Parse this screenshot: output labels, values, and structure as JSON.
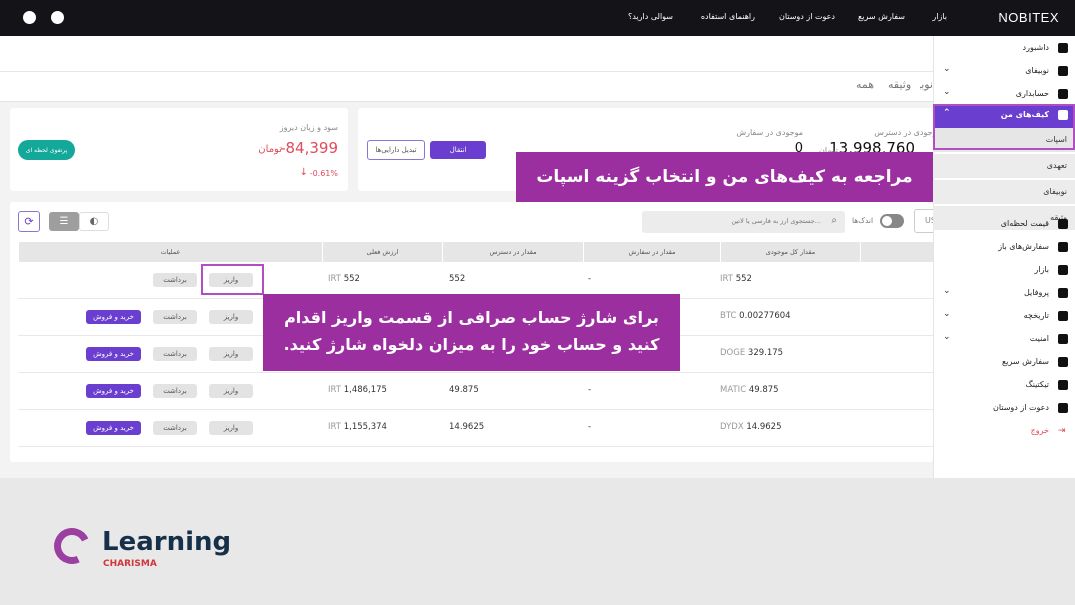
{
  "header": {
    "logo": "NOBITEX",
    "nav": [
      "بازار",
      "سفارش سریع",
      "دعوت از دوستان",
      "راهنمای استفاده",
      "سوالی دارید؟"
    ]
  },
  "tabs": [
    "همه",
    "وثیقه",
    "نوبیفای"
  ],
  "balance_card": {
    "available_label": "موجودی در دسترس",
    "available_value": "13,998,760",
    "available_unit": "تومان",
    "order_label": "موجودی در سفارش",
    "order_value": "0",
    "order_unit": "تومان",
    "transfer_label": "انتقال",
    "convert_label": "تبدیل دارایی‌ها"
  },
  "pnl_card": {
    "label": "سود و زیان دیروز",
    "value": "-84,399",
    "unit": "تومان",
    "percent": "-0.61%",
    "portfolio_label": "پرتفوی لحظه ای"
  },
  "toolbar": {
    "search_placeholder": "جستجوی ارز به فارسی یا لاتین...",
    "small_label": "اندک‌ها",
    "currency": "USDT"
  },
  "table": {
    "headers": [
      "عملیات",
      "ارزش فعلی",
      "مقدار در دسترس",
      "مقدار در سفارش",
      "مقدار کل موجودی"
    ],
    "buttons": {
      "deposit": "واریز",
      "withdraw": "برداشت",
      "trade": "خرید و فروش"
    },
    "rows": [
      {
        "total_unit": "IRT",
        "total": "552",
        "order": "-",
        "available": "552",
        "value_unit": "IRT",
        "value": "552",
        "trade": false
      },
      {
        "total_unit": "BTC",
        "total": "0.00277604",
        "order": "",
        "available": "",
        "value_unit": "",
        "value": "",
        "trade": true
      },
      {
        "total_unit": "DOGE",
        "total": "329.175",
        "order": "",
        "available": "",
        "value_unit": "",
        "value": "",
        "trade": true
      },
      {
        "total_unit": "MATIC",
        "total": "49.875",
        "order": "-",
        "available": "49.875",
        "value_unit": "IRT",
        "value": "1,486,175",
        "trade": true
      },
      {
        "total_unit": "DYDX",
        "total": "14.9625",
        "order": "-",
        "available": "14.9625",
        "value_unit": "IRT",
        "value": "1,155,374",
        "trade": true
      }
    ]
  },
  "sidebar": {
    "items": [
      {
        "label": "داشبورد",
        "chev": false
      },
      {
        "label": "نوبیفای",
        "chev": true
      },
      {
        "label": "حسابداری",
        "chev": true
      }
    ],
    "wallet": "کیف‌های من",
    "sub": [
      "اسپات",
      "تعهدی",
      "نوبیفای",
      "وثیقه"
    ],
    "items2": [
      {
        "label": "قیمت لحظه‌ای",
        "chev": false
      },
      {
        "label": "سفارش‌های باز",
        "chev": false
      },
      {
        "label": "بازار",
        "chev": false
      },
      {
        "label": "پروفایل",
        "chev": true
      },
      {
        "label": "تاریخچه",
        "chev": true
      },
      {
        "label": "امنیت",
        "chev": true
      },
      {
        "label": "سفارش سریع",
        "chev": false
      },
      {
        "label": "تیکتینگ",
        "chev": false
      },
      {
        "label": "دعوت از دوستان",
        "chev": false
      }
    ],
    "logout": "خروج"
  },
  "overlays": {
    "first": "مراجعه به کیف‌های من و انتخاب گزینه اسپات",
    "second_line1": "برای شارژ حساب صرافی از قسمت واریز اقدام",
    "second_line2": "کنید و حساب خود را به میزان دلخواه شارژ کنید."
  },
  "watermark": {
    "brand": "Learning",
    "sub": "CHARISMA"
  },
  "colors": {
    "accent": "#6a3fd0",
    "overlay": "#9c2f9f",
    "negative": "#e04b5a",
    "teal": "#14a89a"
  }
}
